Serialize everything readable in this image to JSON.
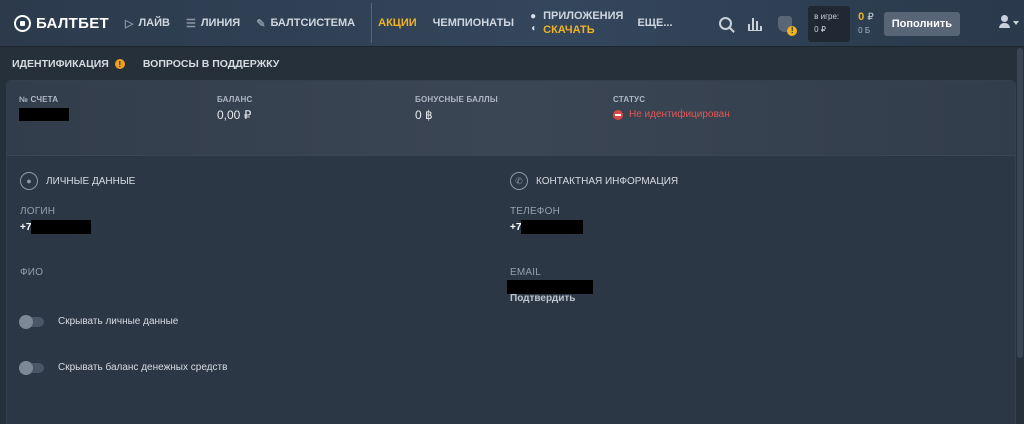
{
  "header": {
    "logo_text": "БАЛТБЕТ",
    "nav": [
      {
        "label": "ЛАЙВ",
        "icon": "play-icon"
      },
      {
        "label": "ЛИНИЯ",
        "icon": "list-icon"
      },
      {
        "label": "БАЛТСИСТЕМА",
        "icon": "guitar-icon"
      }
    ],
    "promo_label": "АКЦИИ",
    "champ_label": "ЧЕМПИОНАТЫ",
    "apps_label": "ПРИЛОЖЕНИЯ",
    "apps_download": "СКАЧАТЬ",
    "more_label": "ЕЩЕ...",
    "in_game_label": "в игре:",
    "in_game_value": "0 ₽",
    "balance_main": "0",
    "balance_currency": "₽",
    "balance_bonus": "0 Б",
    "topup_label": "Пополнить",
    "accent_color": "#f0b323"
  },
  "subtabs": {
    "identification": "ИДЕНТИФИКАЦИЯ",
    "identification_badge": "!",
    "support": "ВОПРОСЫ В ПОДДЕРЖКУ"
  },
  "summary": {
    "account_label": "№ СЧЕТА",
    "balance_label": "БАЛАНС",
    "balance_value": "0,00 ₽",
    "bonus_label": "БОНУСНЫЕ БАЛЛЫ",
    "bonus_value": "0 ฿",
    "status_label": "СТАТУС",
    "status_value": "Не идентифицирован",
    "status_color": "#e05656"
  },
  "personal": {
    "title": "ЛИЧНЫЕ ДАННЫЕ",
    "login_label": "ЛОГИН",
    "login_prefix": "+7",
    "fio_label": "ФИО",
    "toggle_hide_personal": "Скрывать личные данные",
    "toggle_hide_balance": "Скрывать баланс денежных средств"
  },
  "contact": {
    "title": "КОНТАКТНАЯ ИНФОРМАЦИЯ",
    "phone_label": "ТЕЛЕФОН",
    "phone_prefix": "+7",
    "email_label": "EMAIL",
    "confirm_label": "Подтвердить"
  }
}
